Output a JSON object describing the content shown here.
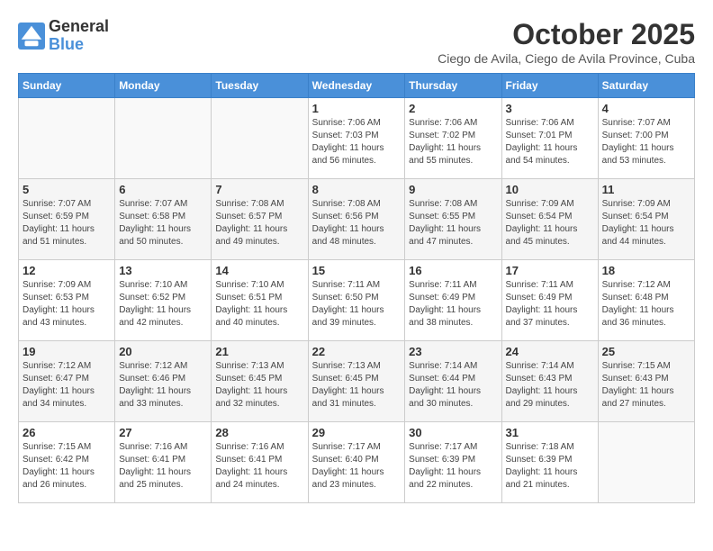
{
  "logo": {
    "general": "General",
    "blue": "Blue"
  },
  "header": {
    "month": "October 2025",
    "location": "Ciego de Avila, Ciego de Avila Province, Cuba"
  },
  "days_of_week": [
    "Sunday",
    "Monday",
    "Tuesday",
    "Wednesday",
    "Thursday",
    "Friday",
    "Saturday"
  ],
  "weeks": [
    [
      {
        "day": "",
        "info": ""
      },
      {
        "day": "",
        "info": ""
      },
      {
        "day": "",
        "info": ""
      },
      {
        "day": "1",
        "info": "Sunrise: 7:06 AM\nSunset: 7:03 PM\nDaylight: 11 hours\nand 56 minutes."
      },
      {
        "day": "2",
        "info": "Sunrise: 7:06 AM\nSunset: 7:02 PM\nDaylight: 11 hours\nand 55 minutes."
      },
      {
        "day": "3",
        "info": "Sunrise: 7:06 AM\nSunset: 7:01 PM\nDaylight: 11 hours\nand 54 minutes."
      },
      {
        "day": "4",
        "info": "Sunrise: 7:07 AM\nSunset: 7:00 PM\nDaylight: 11 hours\nand 53 minutes."
      }
    ],
    [
      {
        "day": "5",
        "info": "Sunrise: 7:07 AM\nSunset: 6:59 PM\nDaylight: 11 hours\nand 51 minutes."
      },
      {
        "day": "6",
        "info": "Sunrise: 7:07 AM\nSunset: 6:58 PM\nDaylight: 11 hours\nand 50 minutes."
      },
      {
        "day": "7",
        "info": "Sunrise: 7:08 AM\nSunset: 6:57 PM\nDaylight: 11 hours\nand 49 minutes."
      },
      {
        "day": "8",
        "info": "Sunrise: 7:08 AM\nSunset: 6:56 PM\nDaylight: 11 hours\nand 48 minutes."
      },
      {
        "day": "9",
        "info": "Sunrise: 7:08 AM\nSunset: 6:55 PM\nDaylight: 11 hours\nand 47 minutes."
      },
      {
        "day": "10",
        "info": "Sunrise: 7:09 AM\nSunset: 6:54 PM\nDaylight: 11 hours\nand 45 minutes."
      },
      {
        "day": "11",
        "info": "Sunrise: 7:09 AM\nSunset: 6:54 PM\nDaylight: 11 hours\nand 44 minutes."
      }
    ],
    [
      {
        "day": "12",
        "info": "Sunrise: 7:09 AM\nSunset: 6:53 PM\nDaylight: 11 hours\nand 43 minutes."
      },
      {
        "day": "13",
        "info": "Sunrise: 7:10 AM\nSunset: 6:52 PM\nDaylight: 11 hours\nand 42 minutes."
      },
      {
        "day": "14",
        "info": "Sunrise: 7:10 AM\nSunset: 6:51 PM\nDaylight: 11 hours\nand 40 minutes."
      },
      {
        "day": "15",
        "info": "Sunrise: 7:11 AM\nSunset: 6:50 PM\nDaylight: 11 hours\nand 39 minutes."
      },
      {
        "day": "16",
        "info": "Sunrise: 7:11 AM\nSunset: 6:49 PM\nDaylight: 11 hours\nand 38 minutes."
      },
      {
        "day": "17",
        "info": "Sunrise: 7:11 AM\nSunset: 6:49 PM\nDaylight: 11 hours\nand 37 minutes."
      },
      {
        "day": "18",
        "info": "Sunrise: 7:12 AM\nSunset: 6:48 PM\nDaylight: 11 hours\nand 36 minutes."
      }
    ],
    [
      {
        "day": "19",
        "info": "Sunrise: 7:12 AM\nSunset: 6:47 PM\nDaylight: 11 hours\nand 34 minutes."
      },
      {
        "day": "20",
        "info": "Sunrise: 7:12 AM\nSunset: 6:46 PM\nDaylight: 11 hours\nand 33 minutes."
      },
      {
        "day": "21",
        "info": "Sunrise: 7:13 AM\nSunset: 6:45 PM\nDaylight: 11 hours\nand 32 minutes."
      },
      {
        "day": "22",
        "info": "Sunrise: 7:13 AM\nSunset: 6:45 PM\nDaylight: 11 hours\nand 31 minutes."
      },
      {
        "day": "23",
        "info": "Sunrise: 7:14 AM\nSunset: 6:44 PM\nDaylight: 11 hours\nand 30 minutes."
      },
      {
        "day": "24",
        "info": "Sunrise: 7:14 AM\nSunset: 6:43 PM\nDaylight: 11 hours\nand 29 minutes."
      },
      {
        "day": "25",
        "info": "Sunrise: 7:15 AM\nSunset: 6:43 PM\nDaylight: 11 hours\nand 27 minutes."
      }
    ],
    [
      {
        "day": "26",
        "info": "Sunrise: 7:15 AM\nSunset: 6:42 PM\nDaylight: 11 hours\nand 26 minutes."
      },
      {
        "day": "27",
        "info": "Sunrise: 7:16 AM\nSunset: 6:41 PM\nDaylight: 11 hours\nand 25 minutes."
      },
      {
        "day": "28",
        "info": "Sunrise: 7:16 AM\nSunset: 6:41 PM\nDaylight: 11 hours\nand 24 minutes."
      },
      {
        "day": "29",
        "info": "Sunrise: 7:17 AM\nSunset: 6:40 PM\nDaylight: 11 hours\nand 23 minutes."
      },
      {
        "day": "30",
        "info": "Sunrise: 7:17 AM\nSunset: 6:39 PM\nDaylight: 11 hours\nand 22 minutes."
      },
      {
        "day": "31",
        "info": "Sunrise: 7:18 AM\nSunset: 6:39 PM\nDaylight: 11 hours\nand 21 minutes."
      },
      {
        "day": "",
        "info": ""
      }
    ]
  ]
}
